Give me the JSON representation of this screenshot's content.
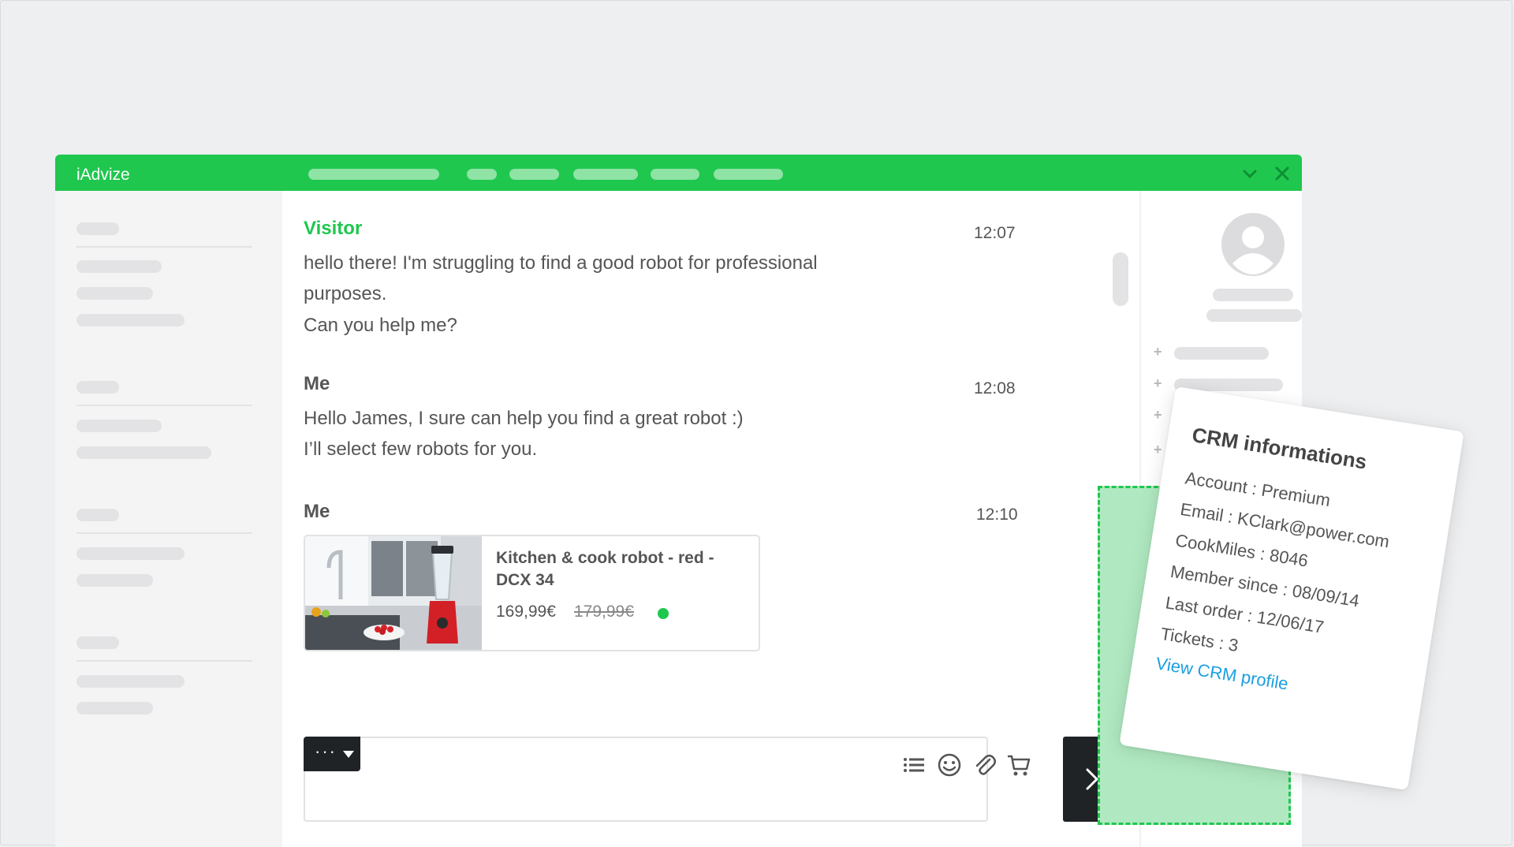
{
  "app": {
    "name": "iAdvize"
  },
  "colors": {
    "brand": "#1fc74e",
    "brand_light": "#b0e9c1",
    "dark_button": "#202326",
    "link": "#1a9fe0",
    "placeholder": "#e3e3e5"
  },
  "window_controls": {
    "minimize_icon": "chevron-down-icon",
    "close_icon": "close-icon"
  },
  "chat": {
    "messages": [
      {
        "sender": "Visitor",
        "time": "12:07",
        "lines": [
          "hello there! I'm struggling to find a good robot for professional",
          "purposes.",
          "Can you help me?"
        ]
      },
      {
        "sender": "Me",
        "time": "12:08",
        "lines": [
          "Hello James, I sure can help you find a great robot :)",
          "I’ll select few robots for you."
        ]
      },
      {
        "sender": "Me",
        "time": "12:10",
        "product": {
          "title": "Kitchen & cook robot - red - DCX 34",
          "price": "169,99€",
          "old_price": "179,99€",
          "in_stock": true
        }
      }
    ]
  },
  "composer": {
    "more_label": "···",
    "tools": [
      "list-icon",
      "emoji-icon",
      "paperclip-icon",
      "cart-icon"
    ],
    "send_icon": "chevron-right-icon"
  },
  "crm": {
    "title": "CRM informations",
    "fields": [
      "Account : Premium",
      "Email : KClark@power.com",
      "CookMiles : 8046",
      "Member since : 08/09/14",
      "Last order : 12/06/17",
      "Tickets : 3"
    ],
    "link": "View CRM profile"
  }
}
